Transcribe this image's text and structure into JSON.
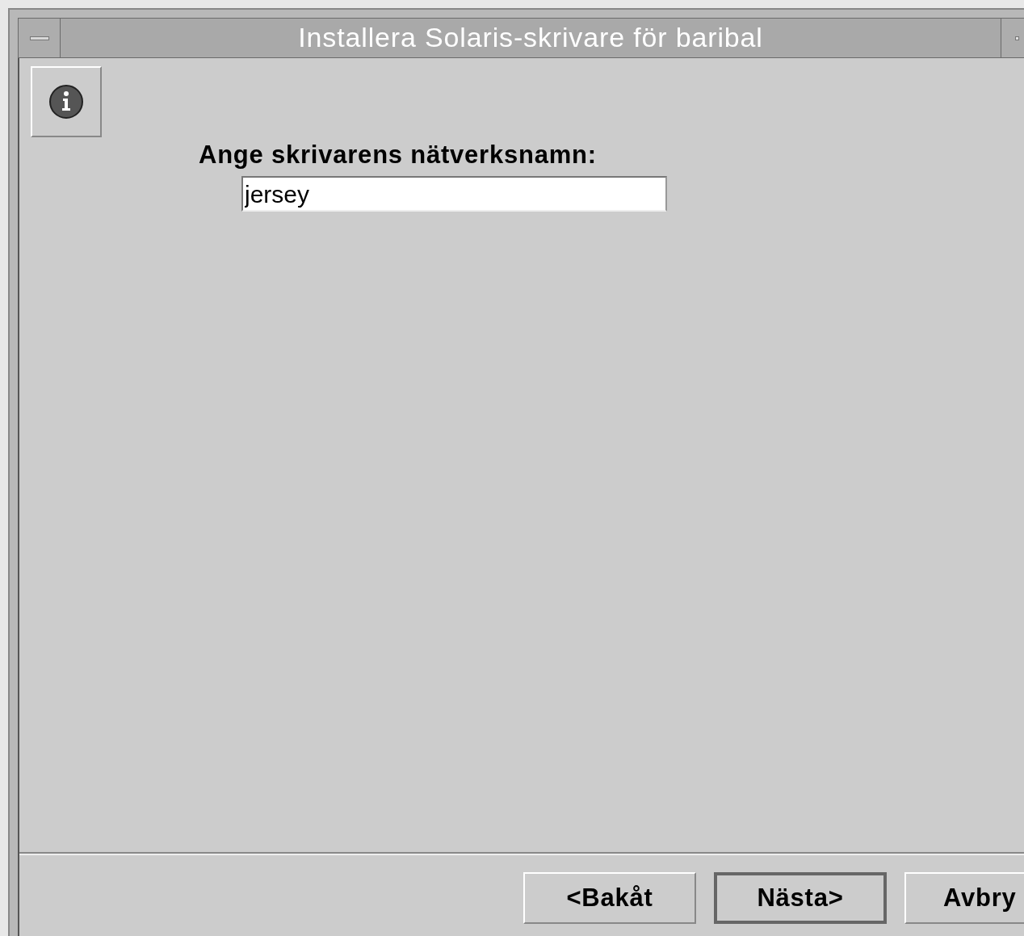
{
  "window": {
    "title": "Installera Solaris-skrivare för baribal"
  },
  "prompt": {
    "label": "Ange skrivarens nätverksnamn:",
    "value": "jersey"
  },
  "buttons": [
    {
      "label": "<Bakåt",
      "default": false
    },
    {
      "label": "Nästa>",
      "default": true
    },
    {
      "label": "Avbry",
      "default": false
    }
  ]
}
